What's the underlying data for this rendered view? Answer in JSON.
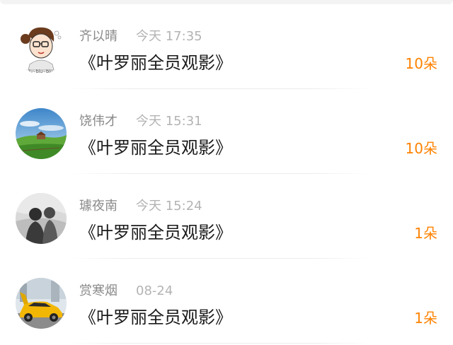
{
  "comments": [
    {
      "avatar": "cartoon-girl-glasses-avatar",
      "avatar_caption": "biu~biu~biu~",
      "name": "齐以晴",
      "time": "今天 17:35",
      "title": "《叶罗丽全员观影》",
      "gift": "10朵"
    },
    {
      "avatar": "landscape-meadow-avatar",
      "name": "饶伟才",
      "time": "今天 15:31",
      "title": "《叶罗丽全员观影》",
      "gift": "10朵"
    },
    {
      "avatar": "two-people-back-view-avatar",
      "name": "璩夜南",
      "time": "今天 15:24",
      "title": "《叶罗丽全员观影》",
      "gift": "1朵"
    },
    {
      "avatar": "yellow-sports-car-avatar",
      "name": "赏寒烟",
      "time": "08-24",
      "title": "《叶罗丽全员观影》",
      "gift": "1朵"
    }
  ],
  "colors": {
    "gift": "#ff8200",
    "name": "#8a8a8a",
    "time": "#b3b3b3",
    "title": "#1a1a1a"
  }
}
